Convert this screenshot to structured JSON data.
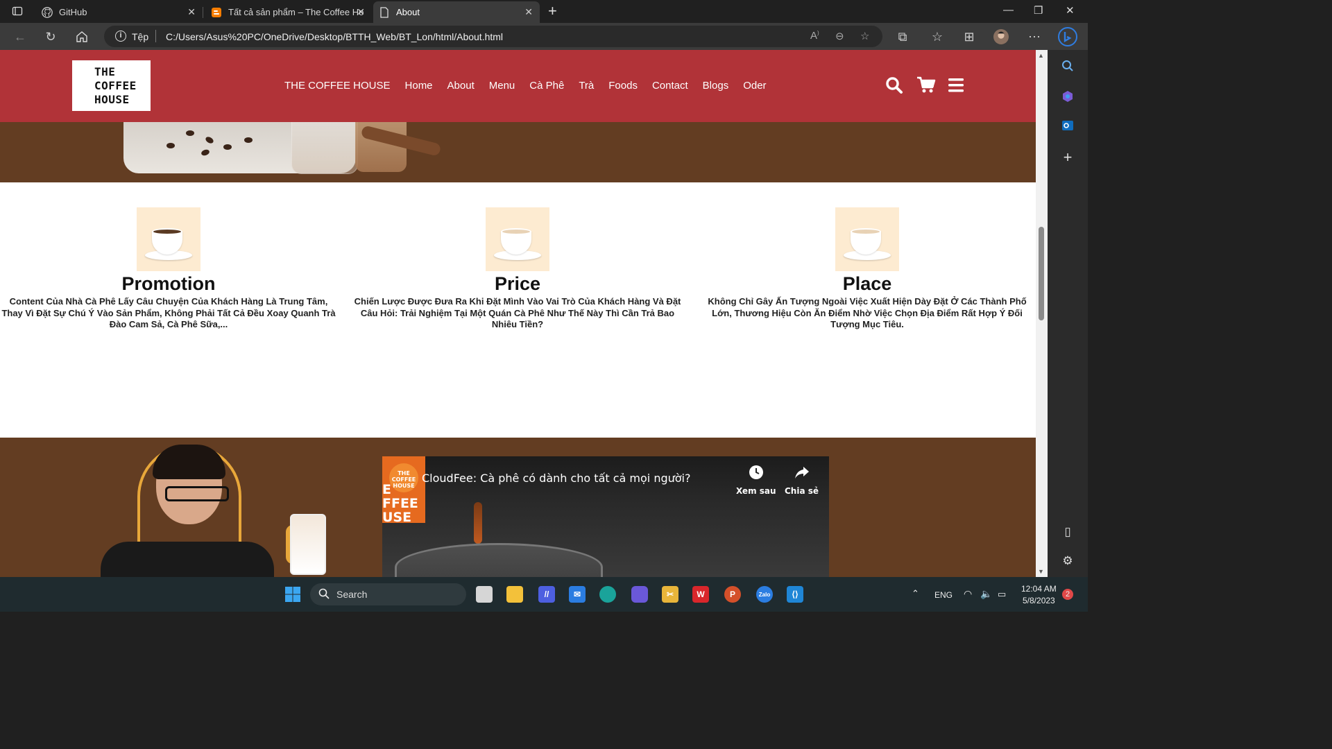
{
  "browser": {
    "tabs": [
      {
        "title": "GitHub",
        "icon": "github-icon"
      },
      {
        "title": "Tất cả sản phẩm – The Coffee Ho",
        "icon": "blogger-icon"
      },
      {
        "title": "About",
        "icon": "page-icon"
      }
    ],
    "protocol_label": "Tệp",
    "url": "C:/Users/Asus%20PC/OneDrive/Desktop/BTTH_Web/BT_Lon/html/About.html"
  },
  "site": {
    "logo": [
      "THE",
      "COFFEE",
      "HOUSE"
    ],
    "nav": [
      "THE COFFEE HOUSE",
      "Home",
      "About",
      "Menu",
      "Cà Phê",
      "Trà",
      "Foods",
      "Contact",
      "Blogs",
      "Oder"
    ],
    "header_icons": [
      "search-icon",
      "cart-icon",
      "menu-icon"
    ],
    "brand_color": "#b13338",
    "brown_color": "#633d22"
  },
  "features": [
    {
      "title": "Promotion",
      "text": "Content Của Nhà Cà Phê Lấy Câu Chuyện Của Khách Hàng Là Trung Tâm, Thay Vì Đặt Sự Chú Ý Vào Sản Phẩm, Không Phải Tất Cả Đều Xoay Quanh Trà Đào Cam Sả, Cà Phê Sữa,..."
    },
    {
      "title": "Price",
      "text": "Chiến Lược Được Đưa Ra Khi Đặt Mình Vào Vai Trò Của Khách Hàng Và Đặt Câu Hỏi: Trải Nghiệm Tại Một Quán Cà Phê Như Thế Này Thì Cần Trả Bao Nhiêu Tiền?"
    },
    {
      "title": "Place",
      "text": "Không Chỉ Gây Ấn Tượng Ngoài Việc Xuất Hiện Dày Đặt Ở Các Thành Phố Lớn, Thương Hiệu Còn Ăn Điểm Nhờ Việc Chọn Địa Điểm Rất Hợp Ý Đối Tượng Mục Tiêu."
    }
  ],
  "video": {
    "title": "CloudFee: Cà phê có dành cho tất cả mọi người?",
    "channel_badge": "THE COFFEE HOUSE",
    "channel_word": [
      "E",
      "FFEE",
      "USE"
    ],
    "watch_later": "Xem sau",
    "share": "Chia sẻ"
  },
  "taskbar": {
    "search_label": "Search",
    "lang": "ENG",
    "time": "12:04 AM",
    "date": "5/8/2023",
    "notif_count": "2",
    "zalo_label": "Zalo"
  }
}
